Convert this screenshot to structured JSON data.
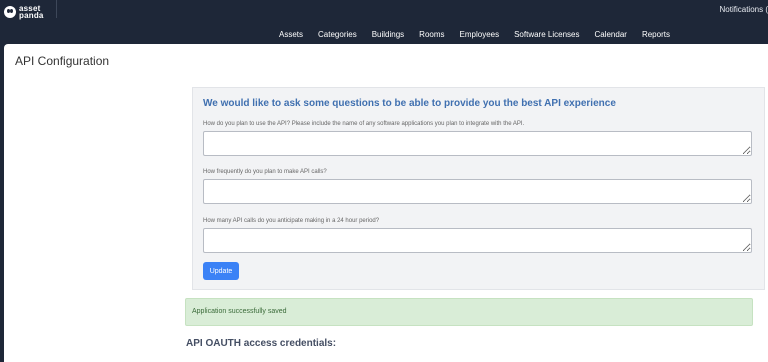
{
  "brand": {
    "name_line1": "asset",
    "name_line2": "panda"
  },
  "header": {
    "notifications_text": "Notifications ("
  },
  "nav": {
    "items": [
      "Assets",
      "Categories",
      "Buildings",
      "Rooms",
      "Employees",
      "Software Licenses",
      "Calendar",
      "Reports"
    ]
  },
  "page": {
    "title": "API Configuration"
  },
  "survey": {
    "heading": "We would like to ask some questions to be able to provide you the best API experience",
    "questions": [
      {
        "label": "How do you plan to use the API? Please include the name of any software applications you plan to integrate with the API.",
        "value": ""
      },
      {
        "label": "How frequently do you plan to make API calls?",
        "value": ""
      },
      {
        "label": "How many API calls do you anticipate making in a 24 hour period?",
        "value": ""
      }
    ],
    "submit_label": "Update"
  },
  "alert": {
    "message": "Application successfully saved"
  },
  "oauth": {
    "heading": "API OAUTH access credentials:"
  },
  "colors": {
    "topbar": "#1e2738",
    "accent": "#3b82f6",
    "heading_blue": "#4070b0",
    "success_bg": "#d9edd7"
  }
}
